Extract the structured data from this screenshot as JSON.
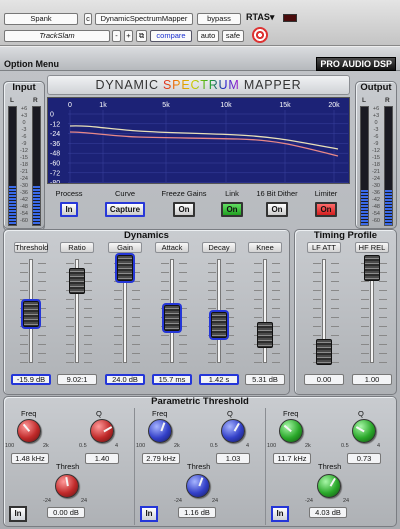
{
  "host": {
    "preset": "Spank",
    "compare_marker": "c",
    "plugin_name": "DynamicSpectrumMapper",
    "bypass": "bypass",
    "format": "RTAS",
    "track": "TrackSlam",
    "minus": "-",
    "plus": "+",
    "compare": "compare",
    "auto": "auto",
    "safe": "safe"
  },
  "plugin": {
    "option_menu": "Option Menu",
    "brand": "PRO AUDIO DSP",
    "title_pre": "DYNAMIC ",
    "title_mid": "SPECTRUM",
    "title_post": " MAPPER"
  },
  "meters": {
    "input_label": "Input",
    "output_label": "Output",
    "left": "L",
    "right": "R",
    "ticks": [
      "+6",
      "+3",
      "0",
      "-3",
      "-6",
      "-9",
      "-12",
      "-15",
      "-18",
      "-21",
      "-24",
      "-30",
      "-36",
      "-42",
      "-48",
      "-54",
      "-60"
    ],
    "input_level": {
      "left": 0.33,
      "right": 0.33
    },
    "output_level": {
      "left": 0.3,
      "right": 0.3
    }
  },
  "graph": {
    "freq_labels": [
      "0",
      "1k",
      "5k",
      "10k",
      "15k",
      "20k"
    ],
    "db_labels": [
      "0",
      "-12",
      "-24",
      "-36",
      "-48",
      "-60",
      "-72",
      "-80"
    ]
  },
  "controls": [
    {
      "label": "Process",
      "value": "In",
      "style": "blue"
    },
    {
      "label": "Curve",
      "value": "Capture",
      "style": "blue"
    },
    {
      "label": "Freeze Gains",
      "value": "On",
      "style": "plain"
    },
    {
      "label": "Link",
      "value": "On",
      "style": "green"
    },
    {
      "label": "16 Bit Dither",
      "value": "On",
      "style": "plain"
    },
    {
      "label": "Limiter",
      "value": "On",
      "style": "red"
    }
  ],
  "dynamics": {
    "title": "Dynamics",
    "labels": [
      "Threshold",
      "Ratio",
      "Gain",
      "Attack",
      "Decay",
      "Knee"
    ],
    "values": [
      "-15.9 dB",
      "9.02:1",
      "24.0 dB",
      "15.7 ms",
      "1.42 s",
      "5.31 dB"
    ],
    "fader_positions": [
      0.55,
      0.15,
      0.0,
      0.6,
      0.68,
      0.8
    ],
    "selected": [
      true,
      false,
      true,
      true,
      true,
      false
    ]
  },
  "timing": {
    "title": "Timing Profile",
    "labels": [
      "LF ATT",
      "HF REL"
    ],
    "values": [
      "0.00",
      "1.00"
    ],
    "fader_positions": [
      1.0,
      0.0
    ]
  },
  "param": {
    "title": "Parametric Threshold",
    "freq_label": "Freq",
    "q_label": "Q",
    "thresh_label": "Thresh",
    "in_label": "In",
    "freq_scale": [
      "100",
      "2k"
    ],
    "q_scale": [
      "0.5",
      "4"
    ],
    "thresh_scale": [
      "-24",
      "24"
    ],
    "bands": [
      {
        "color": "red",
        "freq": "1.48 kHz",
        "q": "1.40",
        "thresh": "0.00 dB"
      },
      {
        "color": "blue",
        "freq": "2.79 kHz",
        "q": "1.03",
        "thresh": "1.16 dB"
      },
      {
        "color": "green",
        "freq": "11.7 kHz",
        "q": "0.73",
        "thresh": "4.03 dB"
      }
    ]
  }
}
